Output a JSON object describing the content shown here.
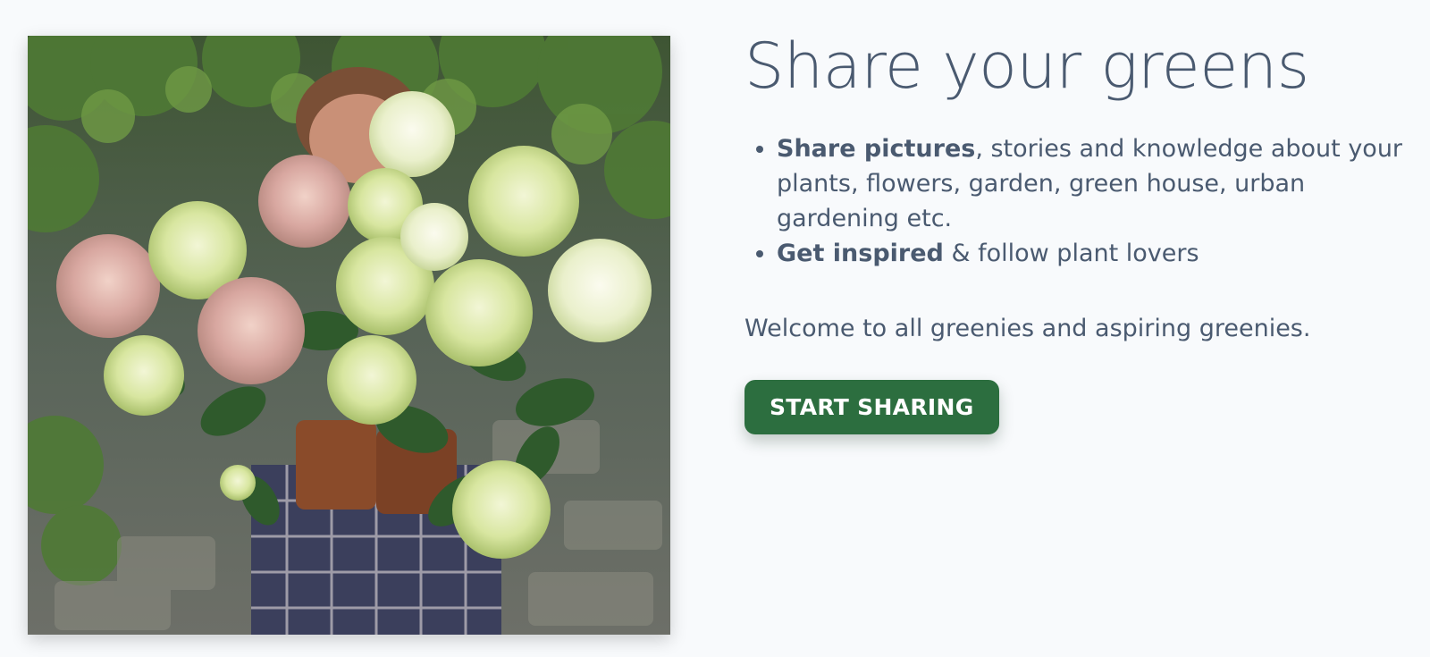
{
  "hero": {
    "title": "Share your greens",
    "features": [
      {
        "bold": "Share pictures",
        "rest": ", stories and knowledge about your plants, flowers, garden, green house, urban gardening etc."
      },
      {
        "bold": "Get inspired",
        "rest": " & follow plant lovers"
      }
    ],
    "welcome": "Welcome to all greenies and aspiring greenies.",
    "cta_label": "START SHARING"
  },
  "colors": {
    "background": "#f8fafc",
    "text": "#4a5a70",
    "cta": "#2c6e3f"
  }
}
